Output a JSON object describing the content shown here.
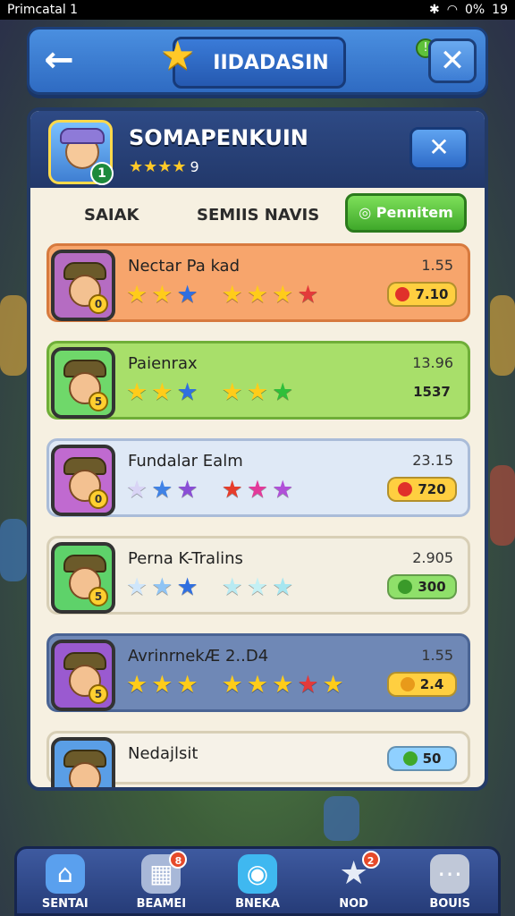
{
  "status_bar": {
    "left_text": "Primcatal 1",
    "battery": "0%",
    "time": "19"
  },
  "header": {
    "title": "IIDADASIN",
    "back_icon": "arrow-left-icon",
    "close_icon": "close-icon"
  },
  "panel": {
    "title": "SOMAPENKUIN",
    "rating_stars": "★★★★",
    "rating_value": "9",
    "close_icon": "close-icon",
    "avatar_level": "1"
  },
  "tabs": [
    {
      "label": "SAIAK"
    },
    {
      "label": "SEMIIS NAVIS"
    },
    {
      "label": "Pennitem"
    }
  ],
  "rows": [
    {
      "name": "Nectar Pa kad",
      "score": "1.55",
      "pill_value": "7.10",
      "bg": "#f7a56c",
      "border": "#d77a3e",
      "avatar_bg": "#b56cc2",
      "badge": "0",
      "pill_color": "#ffcf40",
      "pill_dot": "#e0302a",
      "stars": [
        {
          "glyph": "★",
          "color": "#ffcc1a"
        },
        {
          "glyph": "★",
          "color": "#ffcc1a"
        },
        {
          "glyph": "★",
          "color": "#2f6fe0"
        },
        {
          "glyph": "★",
          "color": "#ffcc1a"
        },
        {
          "glyph": "★",
          "color": "#ffcc1a"
        },
        {
          "glyph": "★",
          "color": "#ffcc1a"
        },
        {
          "glyph": "★",
          "color": "#e33a3a"
        }
      ]
    },
    {
      "name": "Paienrax",
      "score": "13.96",
      "pill_value": "1537",
      "bg": "#a8df6a",
      "border": "#6fae38",
      "avatar_bg": "#6fd86a",
      "badge": "5",
      "pill_color": "transparent",
      "pill_dot": "transparent",
      "stars": [
        {
          "glyph": "★",
          "color": "#ffcc1a"
        },
        {
          "glyph": "★",
          "color": "#ffcc1a"
        },
        {
          "glyph": "★",
          "color": "#2f6fe0"
        },
        {
          "glyph": "★",
          "color": "#ffcc1a"
        },
        {
          "glyph": "★",
          "color": "#ffcc1a"
        },
        {
          "glyph": "★",
          "color": "#2fbf3a"
        }
      ]
    },
    {
      "name": "Fundalar Ealm",
      "score": "23.15",
      "pill_value": "720",
      "bg": "#dfe9f6",
      "border": "#aabcd8",
      "avatar_bg": "#c06ad0",
      "badge": "0",
      "pill_color": "#ffcf40",
      "pill_dot": "#e0302a",
      "stars": [
        {
          "glyph": "★",
          "color": "#d9d4f5"
        },
        {
          "glyph": "★",
          "color": "#3f82e6"
        },
        {
          "glyph": "★",
          "color": "#8a4ed6"
        },
        {
          "glyph": "★",
          "color": "#e63c2a"
        },
        {
          "glyph": "★",
          "color": "#e33a9a"
        },
        {
          "glyph": "★",
          "color": "#b050d8"
        }
      ]
    },
    {
      "name": "Perna K-Tralins",
      "score": "2.905",
      "pill_value": "300",
      "bg": "#f3efe2",
      "border": "#d8cfb6",
      "avatar_bg": "#5ed26a",
      "badge": "5",
      "pill_color": "#8fe06a",
      "pill_dot": "#3a9a2a",
      "stars": [
        {
          "glyph": "★",
          "color": "#cfe6fb"
        },
        {
          "glyph": "★",
          "color": "#8fc4f4"
        },
        {
          "glyph": "★",
          "color": "#2f6fe0"
        },
        {
          "glyph": "★",
          "color": "#b8eaf2"
        },
        {
          "glyph": "★",
          "color": "#c4f0f4"
        },
        {
          "glyph": "★",
          "color": "#a6e6f0"
        }
      ]
    },
    {
      "name": "AvrinrnekÆ 2..D4",
      "score": "1.55",
      "pill_value": "2.4",
      "bg": "#6f88b6",
      "border": "#4a6494",
      "avatar_bg": "#9a5ad0",
      "badge": "5",
      "pill_color": "#ffcf40",
      "pill_dot": "#e89a1a",
      "stars": [
        {
          "glyph": "★",
          "color": "#ffcc1a"
        },
        {
          "glyph": "★",
          "color": "#ffcc1a"
        },
        {
          "glyph": "★",
          "color": "#ffcc1a"
        },
        {
          "glyph": "★",
          "color": "#ffcc1a"
        },
        {
          "glyph": "★",
          "color": "#ffcc1a"
        },
        {
          "glyph": "★",
          "color": "#ffcc1a"
        },
        {
          "glyph": "★",
          "color": "#e33a3a"
        },
        {
          "glyph": "★",
          "color": "#ffcc1a"
        }
      ]
    },
    {
      "name": "Nedajlsit",
      "score": "",
      "pill_value": "50",
      "bg": "#f6f2e8",
      "border": "#d8cfb6",
      "avatar_bg": "#5a9ee6",
      "badge": "",
      "pill_color": "#8fd0ff",
      "pill_dot": "#3fa82a",
      "stars": []
    }
  ],
  "bottom_nav": [
    {
      "label": "SENTAI",
      "icon": "home-icon",
      "glyph": "⌂",
      "badge": "",
      "bg": "#5aa0ee"
    },
    {
      "label": "BEAMEI",
      "icon": "cart-icon",
      "glyph": "▦",
      "badge": "8",
      "bg": "#a8b8d8"
    },
    {
      "label": "BNEKA",
      "icon": "gem-icon",
      "glyph": "◉",
      "badge": "",
      "bg": "#3fb8f0"
    },
    {
      "label": "NOD",
      "icon": "star-icon",
      "glyph": "★",
      "badge": "2",
      "bg": "transparent"
    },
    {
      "label": "BOUIS",
      "icon": "menu-dots-icon",
      "glyph": "⋯",
      "badge": "",
      "bg": "#c0c8d8"
    }
  ]
}
